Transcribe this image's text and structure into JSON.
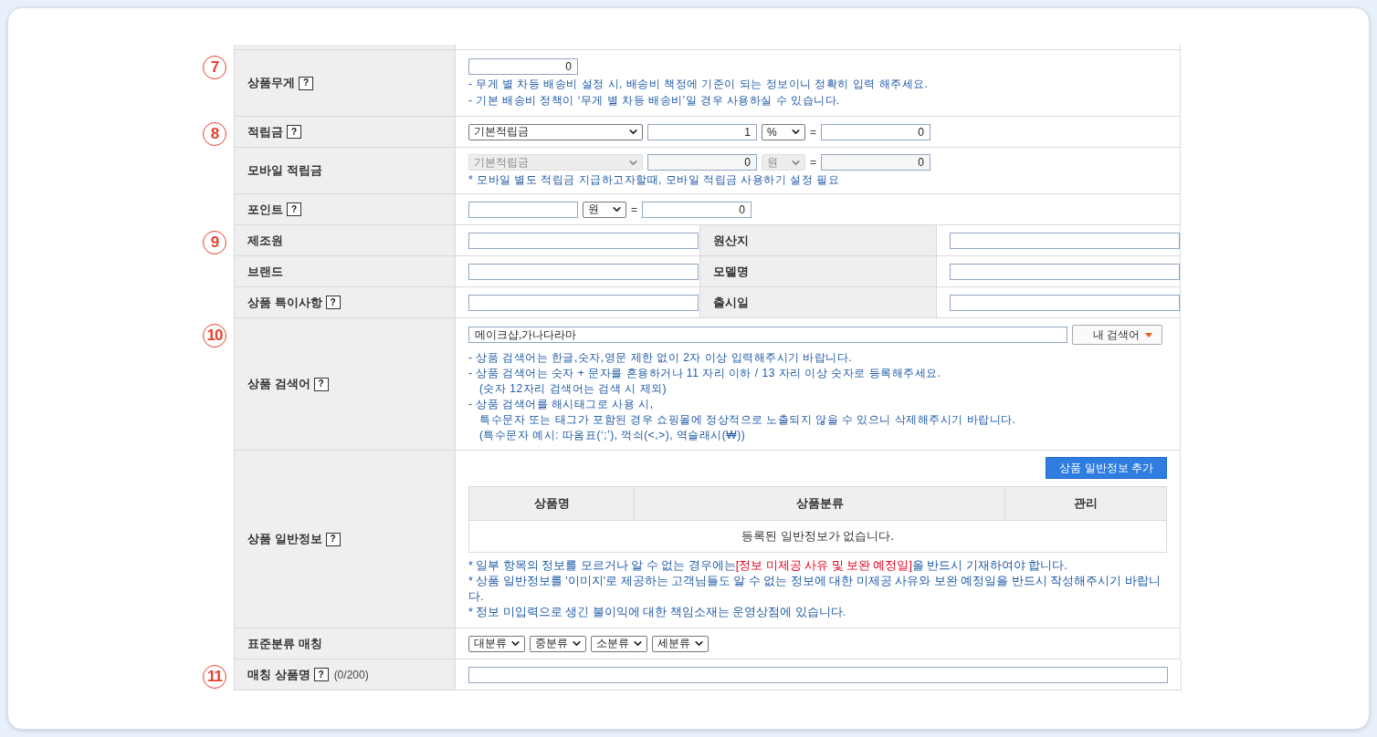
{
  "rows": [
    {
      "kind": "weight",
      "marker": "7",
      "label": "상품무게",
      "help": "?",
      "value": "0",
      "notes": [
        "- 무게 별 차등 배송비 설정 시, 배송비 책정에 기준이 되는 정보이니 정확히 입력 해주세요.",
        "- 기본 배송비 정책이 ‘무게 별 차등 배송비’일 경우 사용하실 수 있습니다."
      ]
    },
    {
      "kind": "reserve",
      "marker": "8",
      "label": "적립금",
      "help": "?",
      "disabled": false,
      "select": "기본적립금",
      "amount": "1",
      "unit": "%",
      "equals": "=",
      "result": "0"
    },
    {
      "kind": "reserve",
      "label": "모바일 적립금",
      "disabled": true,
      "select": "기본적립금",
      "amount": "0",
      "unit": "원",
      "equals": "=",
      "result": "0",
      "note": "* 모바일 별도 적립금 지급하고자할때, 모바일 적립금 사용하기 설정 필요"
    },
    {
      "kind": "reserve",
      "label": "포인트",
      "help": "?",
      "disabled": false,
      "unit": "원",
      "equals": "=",
      "result": "0"
    },
    {
      "kind": "pair",
      "marker": "9",
      "label": "제조원",
      "label2": "원산지"
    },
    {
      "kind": "pair",
      "label": "브랜드",
      "label2": "모델명"
    },
    {
      "kind": "pair",
      "label": "상품 특이사항",
      "help": "?",
      "label2": "출시일"
    },
    {
      "kind": "keywords",
      "marker": "10",
      "label": "상품 검색어",
      "help": "?",
      "value": "메이크샵,가나다라마",
      "button": "내 검색어",
      "notes": [
        {
          "text": "- 상품 검색어는 한글,숫자,영문 제한 없이 2자 이상 입력해주시기 바랍니다.",
          "indented": false
        },
        {
          "text": "- 상품 검색어는 숫자 + 문자를 혼용하거나 11 자리 이하 / 13 자리 이상 숫자로 등록해주세요.",
          "indented": false
        },
        {
          "text": "(숫자 12자리 검색어는 검색 시 제외)",
          "indented": true
        },
        {
          "text": "- 상품 검색어를 해시태그로 사용 시,",
          "indented": false
        },
        {
          "text": "특수문자 또는 태그가 포함된 경우 쇼핑몰에 정상적으로 노출되지 않을 수 있으니 삭제해주시기 바랍니다.",
          "indented": true
        },
        {
          "text": "(특수문자 예시: 따옴표(‘;’), 꺽쇠(<,>), 역슬래시(₩))",
          "indented": true
        }
      ]
    },
    {
      "kind": "general",
      "label": "상품 일반정보",
      "help": "?",
      "button": "상품 일반정보 추가",
      "columns": [
        "상품명",
        "상품분류",
        "관리"
      ],
      "empty": "등록된 일반정보가 없습니다.",
      "notes": [
        {
          "before": "* 일부 항목의 정보를 모르거나 알 수 없는 경우에는",
          "highlight": "[정보 미제공 사유 및 보완 예정일]",
          "after": "을 반드시 기재하여야 합니다."
        },
        {
          "before": "* 상품 일반정보를 '이미지'로 제공하는 고객님들도 알 수 없는 정보에 대한 미제공 사유와 보완 예정일을 반드시 작성해주시기 바랍니다."
        },
        {
          "before": "* 정보 미입력으로 생긴 불이익에 대한 책임소재는 운영상점에 있습니다."
        }
      ]
    },
    {
      "kind": "category",
      "label": "표준분류 매칭",
      "selects": [
        "대분류",
        "중분류",
        "소분류",
        "세분류"
      ]
    },
    {
      "kind": "matching",
      "marker": "11",
      "label": "매칭 상품명",
      "help": "?",
      "count": "(0/200)"
    }
  ]
}
